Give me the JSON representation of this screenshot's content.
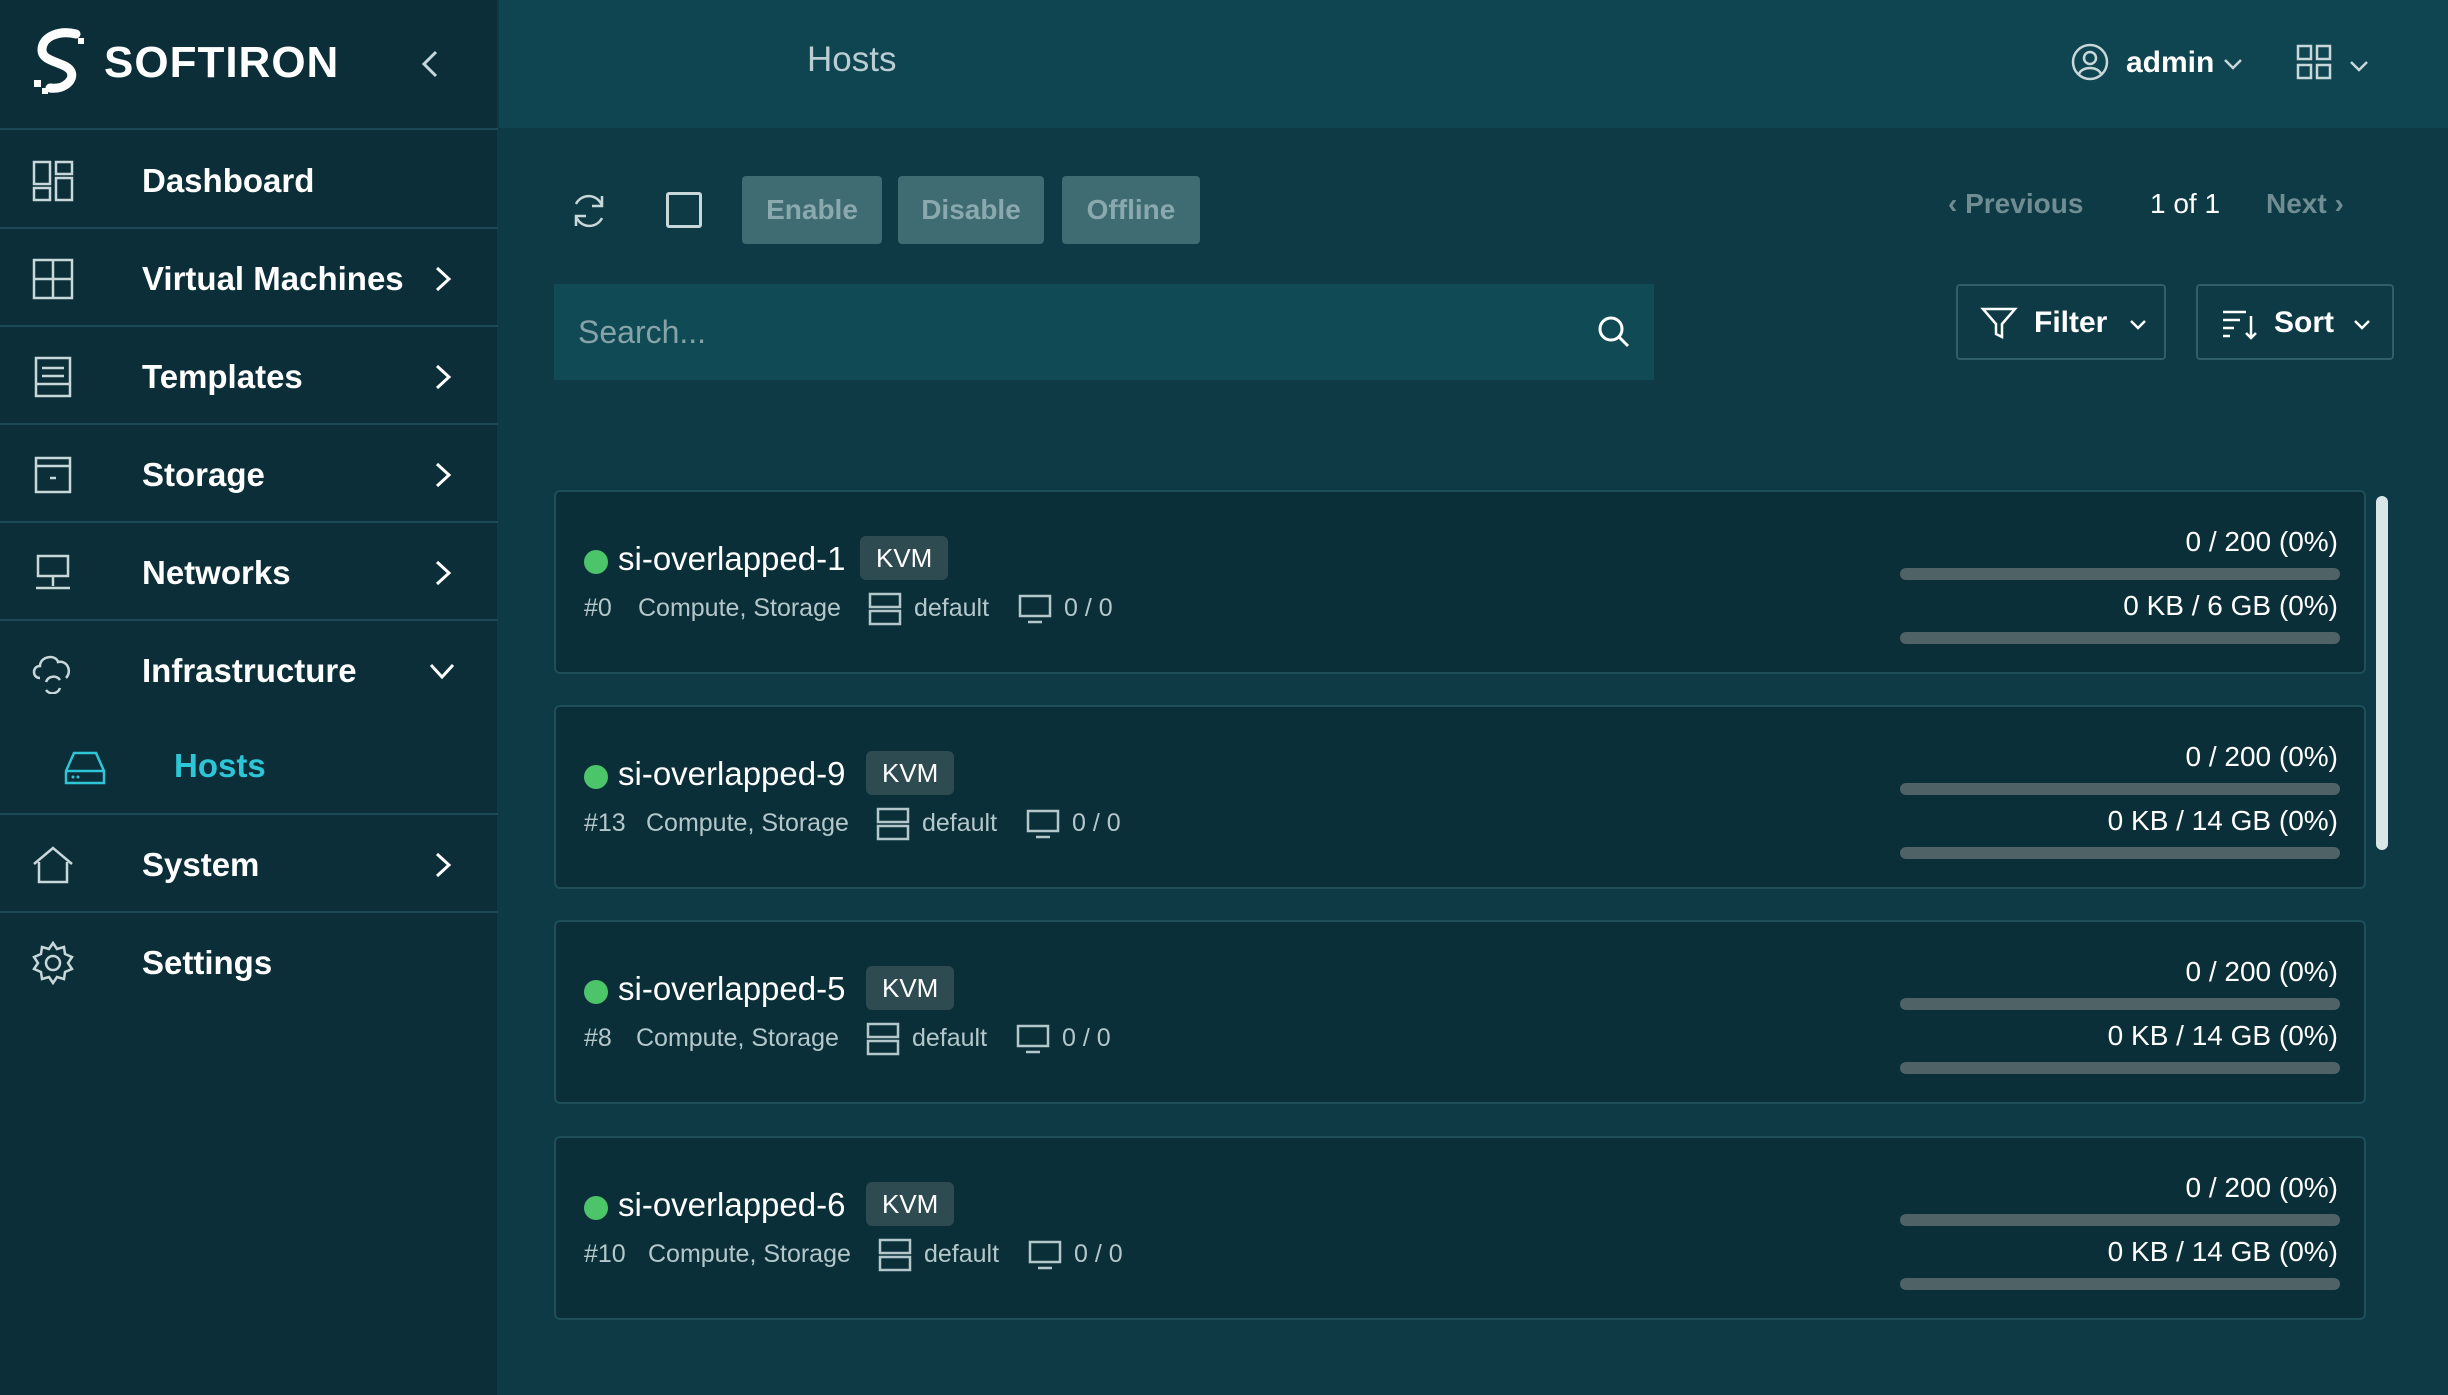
{
  "brand": {
    "name": "SOFTIRON"
  },
  "sidebar": {
    "items": [
      {
        "label": "Dashboard",
        "icon": "dashboard-icon",
        "has_chevron": false
      },
      {
        "label": "Virtual Machines",
        "icon": "virtual-machines-icon",
        "has_chevron": true
      },
      {
        "label": "Templates",
        "icon": "templates-icon",
        "has_chevron": true
      },
      {
        "label": "Storage",
        "icon": "storage-icon",
        "has_chevron": true
      },
      {
        "label": "Networks",
        "icon": "networks-icon",
        "has_chevron": true
      },
      {
        "label": "Infrastructure",
        "icon": "cloud-sync-icon",
        "has_chevron": true,
        "expanded": true
      },
      {
        "label": "System",
        "icon": "home-icon",
        "has_chevron": true
      },
      {
        "label": "Settings",
        "icon": "gear-icon",
        "has_chevron": false
      }
    ],
    "sub_items": [
      {
        "label": "Hosts",
        "icon": "hard-drive-icon",
        "active": true
      }
    ]
  },
  "header": {
    "title": "Hosts",
    "user": "admin"
  },
  "toolbar": {
    "enable_label": "Enable",
    "disable_label": "Disable",
    "offline_label": "Offline",
    "previous_label": "Previous",
    "page_indicator": "1 of 1",
    "next_label": "Next"
  },
  "search": {
    "placeholder": "Search...",
    "value": ""
  },
  "filter_label": "Filter",
  "sort_label": "Sort",
  "colors": {
    "accent": "#2ec6d6",
    "status_online": "#4cc56a",
    "background": "#0d3a44",
    "sidebar": "#0b2e38"
  },
  "hosts": [
    {
      "name": "si-overlapped-1",
      "type": "KVM",
      "id": "#0",
      "roles": "Compute, Storage",
      "cluster": "default",
      "vms": "0 / 0",
      "cpu": "0 / 200 (0%)",
      "cpu_fraction": 0,
      "memory": "0 KB / 6 GB (0%)",
      "memory_fraction": 0
    },
    {
      "name": "si-overlapped-9",
      "type": "KVM",
      "id": "#13",
      "roles": "Compute, Storage",
      "cluster": "default",
      "vms": "0 / 0",
      "cpu": "0 / 200 (0%)",
      "cpu_fraction": 0,
      "memory": "0 KB / 14 GB (0%)",
      "memory_fraction": 0
    },
    {
      "name": "si-overlapped-5",
      "type": "KVM",
      "id": "#8",
      "roles": "Compute, Storage",
      "cluster": "default",
      "vms": "0 / 0",
      "cpu": "0 / 200 (0%)",
      "cpu_fraction": 0,
      "memory": "0 KB / 14 GB (0%)",
      "memory_fraction": 0
    },
    {
      "name": "si-overlapped-6",
      "type": "KVM",
      "id": "#10",
      "roles": "Compute, Storage",
      "cluster": "default",
      "vms": "0 / 0",
      "cpu": "0 / 200 (0%)",
      "cpu_fraction": 0,
      "memory": "0 KB / 14 GB (0%)",
      "memory_fraction": 0
    }
  ]
}
